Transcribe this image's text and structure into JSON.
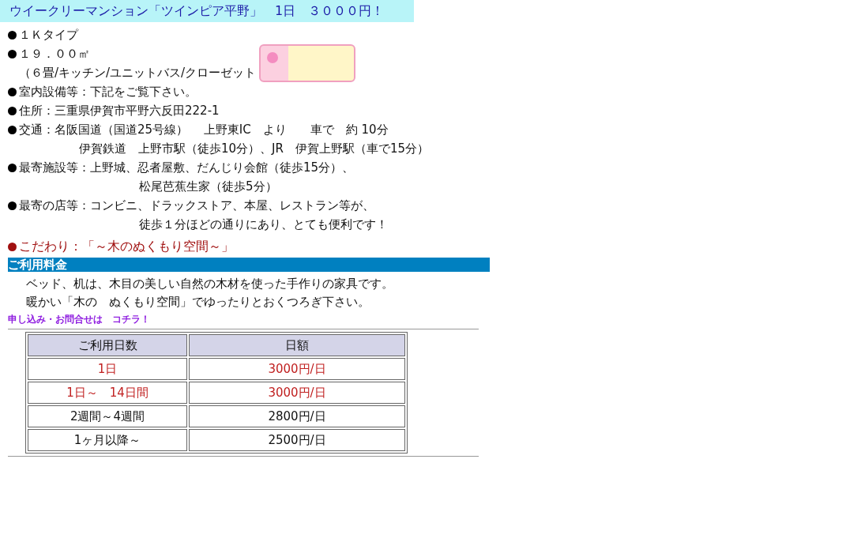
{
  "header": {
    "title": "ウイークリーマンション「ツインピア平野」　1日　３０００円！"
  },
  "details": [
    {
      "text": "１Ｋタイプ"
    },
    {
      "text": "１９．００㎡",
      "sub": [
        {
          "kind": "note",
          "text": "（６畳/キッチン/ユニットバス/クローゼット"
        }
      ],
      "banner": true
    },
    {
      "text": "室内設備等：下記をご覧下さい。"
    },
    {
      "text": "住所：三重県伊賀市平野六反田222-1"
    },
    {
      "text": "交通：名阪国道（国道25号線）　 上野東IC　より　　車で　約 10分",
      "sub": [
        {
          "kind": "wide",
          "text": "伊賀鉄道　上野市駅（徒歩10分）、JR　伊賀上野駅（車で15分）"
        }
      ]
    },
    {
      "text": "最寄施設等：上野城、忍者屋敷、だんじり会館（徒歩15分）、",
      "sub": [
        {
          "kind": "aligned",
          "text": "松尾芭蕉生家（徒歩5分）"
        }
      ]
    },
    {
      "text": "最寄の店等：コンビニ、ドラックストア、本屋、レストラン等が、",
      "sub": [
        {
          "kind": "aligned",
          "text": "徒歩１分ほどの通りにあり、とても便利です！"
        }
      ]
    }
  ],
  "feature": {
    "text": "こだわり：「～木のぬくもり空間～」"
  },
  "pricing": {
    "heading": "ご利用料金",
    "paragraphs": [
      "ベッド、机は、木目の美しい自然の木材を使った手作りの家具です。",
      "暖かい「木の　ぬくもり空間」でゆったりとおくつろぎ下さい。"
    ],
    "link": "申し込み・お問合せは　コチラ！",
    "columns": [
      "ご利用日数",
      "日額"
    ],
    "rows": [
      {
        "days": "1日",
        "price": "3000円/日",
        "highlight": true
      },
      {
        "days": "1日～　14日間",
        "price": "3000円/日",
        "highlight": true
      },
      {
        "days": "2週間～4週間",
        "price": "2800円/日",
        "highlight": false
      },
      {
        "days": "1ヶ月以降～",
        "price": "2500円/日",
        "highlight": false
      }
    ]
  }
}
